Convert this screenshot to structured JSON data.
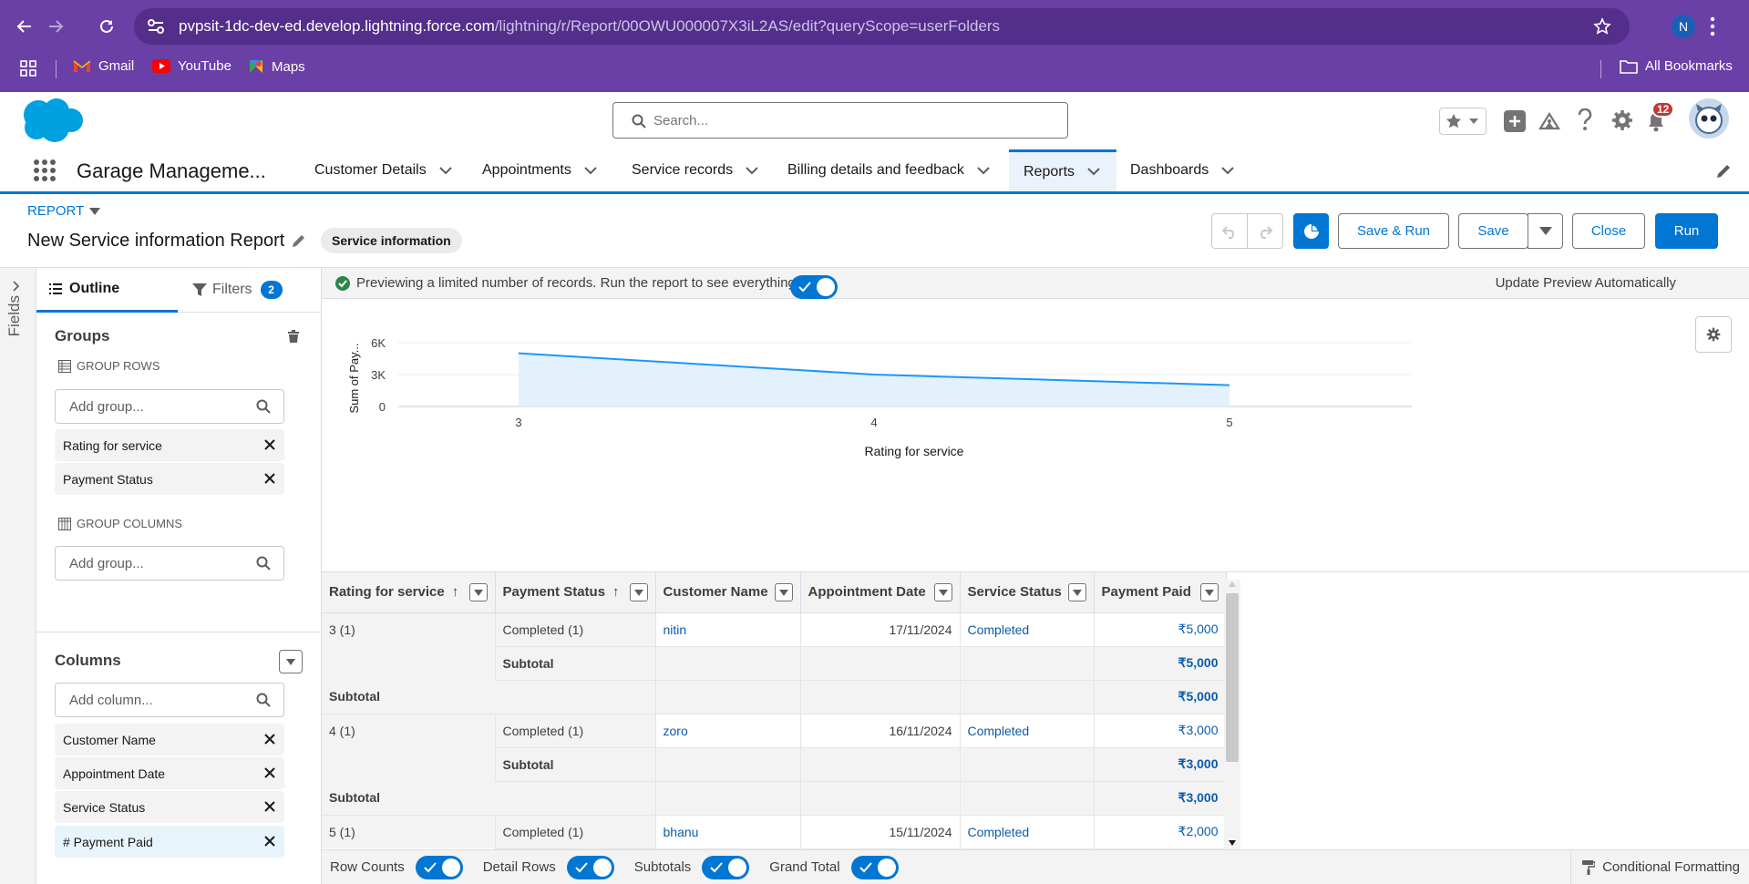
{
  "browser": {
    "url_host": "pvpsit-1dc-dev-ed.develop.lightning.force.com",
    "url_path": "/lightning/r/Report/00OWU000007X3iL2AS/edit?queryScope=userFolders",
    "profile_initial": "N",
    "bookmarks": [
      "Gmail",
      "YouTube",
      "Maps"
    ],
    "all_bookmarks": "All Bookmarks"
  },
  "header": {
    "search_placeholder": "Search...",
    "notification_count": "12",
    "app_name": "Garage Manageme...",
    "nav": [
      "Customer Details",
      "Appointments",
      "Service records",
      "Billing details and feedback",
      "Reports",
      "Dashboards"
    ],
    "active_nav": "Reports"
  },
  "report": {
    "type_label": "REPORT",
    "title": "New Service information Report",
    "report_type_badge": "Service information",
    "buttons": {
      "save_run": "Save & Run",
      "save": "Save",
      "close": "Close",
      "run": "Run"
    }
  },
  "left": {
    "fields_label": "Fields",
    "tabs": {
      "outline": "Outline",
      "filters": "Filters",
      "filters_count": "2"
    },
    "groups_title": "Groups",
    "group_rows_label": "GROUP ROWS",
    "add_group_placeholder": "Add group...",
    "group_rows": [
      "Rating for service",
      "Payment Status"
    ],
    "group_columns_label": "GROUP COLUMNS",
    "columns_title": "Columns",
    "add_column_placeholder": "Add column...",
    "columns": [
      "Customer Name",
      "Appointment Date",
      "Service Status",
      "# Payment Paid"
    ]
  },
  "banner": {
    "message": "Previewing a limited number of records. Run the report to see everything.",
    "update_label": "Update Preview Automatically"
  },
  "chart_data": {
    "type": "area",
    "x": [
      "3",
      "4",
      "5"
    ],
    "series": [
      {
        "values": [
          5000,
          3000,
          2000
        ]
      }
    ],
    "yticks": [
      "6K",
      "3K",
      "0"
    ],
    "ylim": [
      0,
      6000
    ],
    "xlabel": "Rating for service",
    "ylabel": "Sum of Pay...",
    "color": "#1b96ff"
  },
  "table": {
    "headers": [
      "Rating for service",
      "Payment Status",
      "Customer Name",
      "Appointment Date",
      "Service Status",
      "Payment Paid"
    ],
    "sorted_arrows": [
      "↑",
      "↑",
      "",
      "",
      "",
      ""
    ],
    "rows": [
      {
        "kind": "detail",
        "cells": [
          "3 (1)",
          "Completed (1)",
          "nitin",
          "17/11/2024",
          "Completed",
          "₹5,000"
        ]
      },
      {
        "kind": "sub2",
        "cells": [
          "",
          "Subtotal",
          "",
          "",
          "",
          "₹5,000"
        ]
      },
      {
        "kind": "sub1",
        "cells": [
          "Subtotal",
          "",
          "",
          "",
          "",
          "₹5,000"
        ]
      },
      {
        "kind": "detail",
        "cells": [
          "4 (1)",
          "Completed (1)",
          "zoro",
          "16/11/2024",
          "Completed",
          "₹3,000"
        ]
      },
      {
        "kind": "sub2",
        "cells": [
          "",
          "Subtotal",
          "",
          "",
          "",
          "₹3,000"
        ]
      },
      {
        "kind": "sub1",
        "cells": [
          "Subtotal",
          "",
          "",
          "",
          "",
          "₹3,000"
        ]
      },
      {
        "kind": "detail",
        "cells": [
          "5 (1)",
          "Completed (1)",
          "bhanu",
          "15/11/2024",
          "Completed",
          "₹2,000"
        ]
      }
    ]
  },
  "footer": {
    "toggles": [
      "Row Counts",
      "Detail Rows",
      "Subtotals",
      "Grand Total"
    ],
    "conditional": "Conditional Formatting"
  }
}
